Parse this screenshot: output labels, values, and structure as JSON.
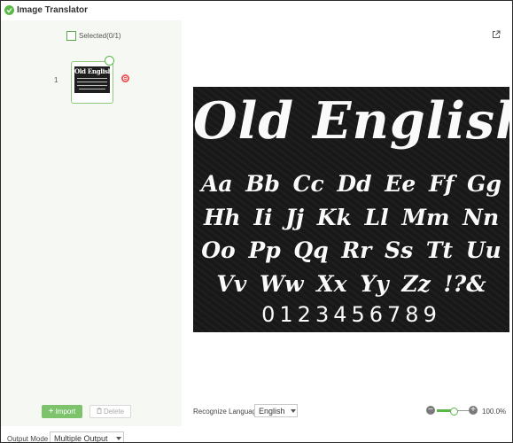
{
  "app": {
    "title": "Image Translator",
    "accent_color": "#5bb848"
  },
  "sidebar": {
    "selected_label": "Selected(0/1)",
    "item_index": "1",
    "thumbnail_caption": "Old English",
    "import_label": "Import",
    "delete_label": "Delete"
  },
  "preview": {
    "title": "Old English",
    "rows": [
      "Aa Bb Cc Dd Ee Ff Gg",
      "Hh Ii Jj Kk Ll Mm Nn",
      "Oo Pp Qq Rr Ss Tt Uu",
      "Vv Ww Xx Yy Zz !?&"
    ],
    "digits": "0123456789"
  },
  "controls": {
    "recognize_label": "Recognize Language",
    "language_value": "English",
    "zoom_value": "100.0%",
    "zoom_level": 0.5
  },
  "footer": {
    "output_mode_label": "Output Mode",
    "output_mode_value": "Multiple Output"
  },
  "icons": [
    "app-logo-icon",
    "export-icon",
    "check-icon",
    "delete-badge-icon",
    "plus-icon",
    "trash-icon",
    "chevron-down-icon",
    "zoom-out-icon",
    "zoom-in-icon"
  ]
}
